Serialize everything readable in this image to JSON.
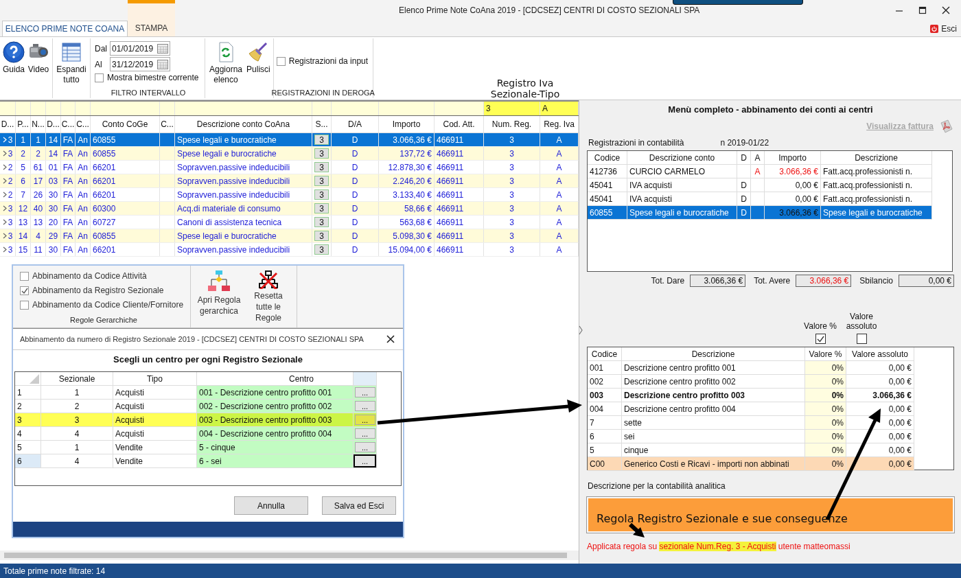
{
  "window": {
    "title": "Elenco Prime Note CoAna 2019 - [CDCSEZ] CENTRI DI COSTO SEZIONALI SPA",
    "exit_label": "Esci"
  },
  "ribbon": {
    "tabs": [
      {
        "label": "ELENCO PRIME NOTE COANA",
        "selected": true
      },
      {
        "label": "STAMPA",
        "selected": false
      }
    ],
    "guide": "Guida",
    "video": "Video",
    "expand": "Espandi tutto",
    "date_filter": {
      "from_label": "Dal",
      "from": "01/01/2019",
      "to_label": "Al",
      "to": "31/12/2019",
      "bimester": {
        "label": "Mostra bimestre corrente",
        "checked": false
      },
      "group_label": "FILTRO INTERVALLO"
    },
    "refresh": "Aggiorna elenco",
    "clear": "Pulisci",
    "exceptions": {
      "input": {
        "label": "Registrazioni da input",
        "checked": false
      },
      "group_label": "REGISTRAZIONI IN DEROGA"
    }
  },
  "grid": {
    "filter_caption": "Registro Iva Sezionale-Tipo",
    "filters": {
      "num_reg": "3",
      "reg_iva": "A"
    },
    "columns": [
      "D...",
      "P...",
      "N...",
      "D...",
      "C...",
      "C...",
      "Conto CoGe",
      "C...",
      "Descrizione conto CoAna",
      "S...",
      "D/A",
      "Importo",
      "Cod. Att.",
      "Num. Reg.",
      "Reg. Iva"
    ],
    "rows": [
      {
        "d": "3",
        "p": "1",
        "n": "1",
        "d2": "14",
        "c": "FA",
        "c2": "An",
        "conto": "60855",
        "descrizione": "Spese legali e burocratiche",
        "s": "3",
        "da": "D",
        "importo": "3.066,36 €",
        "cod_att": "466911",
        "num_reg": "3",
        "reg_iva": "A",
        "selected": true
      },
      {
        "d": "3",
        "p": "2",
        "n": "2",
        "d2": "14",
        "c": "FA",
        "c2": "An",
        "conto": "60855",
        "descrizione": "Spese legali e burocratiche",
        "s": "3",
        "da": "D",
        "importo": "137,72 €",
        "cod_att": "466911",
        "num_reg": "3",
        "reg_iva": "A",
        "selected": false
      },
      {
        "d": "2",
        "p": "5",
        "n": "61",
        "d2": "01",
        "c": "FA",
        "c2": "An",
        "conto": "66201",
        "descrizione": "Sopravven.passive indeducibili",
        "s": "3",
        "da": "D",
        "importo": "12.878,30 €",
        "cod_att": "466911",
        "num_reg": "3",
        "reg_iva": "A",
        "selected": false
      },
      {
        "d": "2",
        "p": "6",
        "n": "17",
        "d2": "03",
        "c": "FA",
        "c2": "An",
        "conto": "66201",
        "descrizione": "Sopravven.passive indeducibili",
        "s": "3",
        "da": "D",
        "importo": "2.246,20 €",
        "cod_att": "466911",
        "num_reg": "3",
        "reg_iva": "A",
        "selected": false
      },
      {
        "d": "2",
        "p": "7",
        "n": "26",
        "d2": "30",
        "c": "FA",
        "c2": "An",
        "conto": "66201",
        "descrizione": "Sopravven.passive indeducibili",
        "s": "3",
        "da": "D",
        "importo": "3.133,40 €",
        "cod_att": "466911",
        "num_reg": "3",
        "reg_iva": "A",
        "selected": false
      },
      {
        "d": "3",
        "p": "12",
        "n": "40",
        "d2": "30",
        "c": "FA",
        "c2": "An",
        "conto": "60300",
        "descrizione": "Acq.di materiale di consumo",
        "s": "3",
        "da": "D",
        "importo": "58,66 €",
        "cod_att": "466911",
        "num_reg": "3",
        "reg_iva": "A",
        "selected": false
      },
      {
        "d": "3",
        "p": "13",
        "n": "13",
        "d2": "20",
        "c": "FA",
        "c2": "An",
        "conto": "60727",
        "descrizione": "Canoni di assistenza tecnica",
        "s": "3",
        "da": "D",
        "importo": "563,68 €",
        "cod_att": "466911",
        "num_reg": "3",
        "reg_iva": "A",
        "selected": false
      },
      {
        "d": "3",
        "p": "14",
        "n": "4",
        "d2": "29",
        "c": "FA",
        "c2": "An",
        "conto": "60855",
        "descrizione": "Spese legali e burocratiche",
        "s": "3",
        "da": "D",
        "importo": "5.098,30 €",
        "cod_att": "466911",
        "num_reg": "3",
        "reg_iva": "A",
        "selected": false
      },
      {
        "d": "3",
        "p": "15",
        "n": "11",
        "d2": "30",
        "c": "FA",
        "c2": "An",
        "conto": "66201",
        "descrizione": "Sopravven.passive indeducibili",
        "s": "3",
        "da": "D",
        "importo": "15.094,00 €",
        "cod_att": "466911",
        "num_reg": "3",
        "reg_iva": "A",
        "selected": false
      }
    ]
  },
  "accounts_panel": {
    "title": "Menù completo - abbinamento dei conti ai centri",
    "invoice_link": "Visualizza fattura",
    "section_label": "Registrazioni in contabilità",
    "doc_number": "n 2019-01/22",
    "columns": [
      "Codice",
      "Descrizione conto",
      "D",
      "A",
      "Importo",
      "Descrizione"
    ],
    "rows": [
      {
        "codice": "412736",
        "conto": "CURCIO CARMELO",
        "a": "A",
        "importo": "3.066,36 €",
        "descrizione": "Fatt.acq.professionisti n.",
        "kind": "avere",
        "selected": false
      },
      {
        "codice": "45041",
        "conto": "IVA acquisti",
        "d": "D",
        "importo": "0,00 €",
        "descrizione": "Fatt.acq.professionisti n.",
        "kind": "dare",
        "selected": false
      },
      {
        "codice": "45041",
        "conto": "IVA acquisti",
        "d": "D",
        "importo": "0,00 €",
        "descrizione": "Fatt.acq.professionisti n.",
        "kind": "dare",
        "selected": false
      },
      {
        "codice": "60855",
        "conto": "Spese legali e burocratiche",
        "d": "D",
        "importo": "3.066,36 €",
        "descrizione": "Spese legali e burocratiche",
        "kind": "dare",
        "selected": true
      }
    ],
    "totals": [
      {
        "label": "Tot. Dare",
        "value": "3.066,36 €",
        "kind": "dare"
      },
      {
        "label": "Tot. Avere",
        "value": "3.066,36 €",
        "kind": "avere"
      },
      {
        "label": "Sbilancio",
        "value": "0,00 €",
        "kind": "balance"
      }
    ]
  },
  "centers_panel": {
    "value_modes": [
      {
        "label": "Valore %",
        "checked": true
      },
      {
        "label": "Valore assoluto",
        "checked": false
      }
    ],
    "columns": [
      "Codice",
      "Descrizione",
      "Valore %",
      "Valore assoluto"
    ],
    "rows": [
      {
        "codice": "001",
        "descrizione": "Descrizione centro profitto 001",
        "percent": "0%",
        "value": "0,00 €",
        "kind": "center",
        "highlighted": false
      },
      {
        "codice": "002",
        "descrizione": "Descrizione centro profitto 002",
        "percent": "0%",
        "value": "0,00 €",
        "kind": "center",
        "highlighted": false
      },
      {
        "codice": "003",
        "descrizione": "Descrizione centro profitto 003",
        "percent": "0%",
        "value": "3.066,36 €",
        "kind": "center",
        "highlighted": true
      },
      {
        "codice": "004",
        "descrizione": "Descrizione centro profitto 004",
        "percent": "0%",
        "value": "0,00 €",
        "kind": "center",
        "highlighted": false
      },
      {
        "codice": "7",
        "descrizione": "sette",
        "percent": "0%",
        "value": "0,00 €",
        "kind": "center",
        "highlighted": false
      },
      {
        "codice": "6",
        "descrizione": "sei",
        "percent": "0%",
        "value": "0,00 €",
        "kind": "center",
        "highlighted": false
      },
      {
        "codice": "5",
        "descrizione": "cinque",
        "percent": "0%",
        "value": "0,00 €",
        "kind": "center",
        "highlighted": false
      },
      {
        "codice": "C00",
        "descrizione": "Generico Costi e Ricavi - importi non abbinati",
        "percent": "0%",
        "value": "0,00 €",
        "kind": "generic",
        "highlighted": false
      }
    ],
    "analytic_label": "Descrizione per la contabilità analitica",
    "analytic_description": "Regola Registro Sezionale e sue conseguenze",
    "rule_note": {
      "text": "Applicata regola su",
      "highlight": "sezionale Num.Reg. 3 - Acquisti",
      "user": "utente matteomassi"
    }
  },
  "rules_panel": {
    "options": [
      {
        "label": "Abbinamento da Codice Attività",
        "checked": false
      },
      {
        "label": "Abbinamento da Registro Sezionale",
        "checked": true
      },
      {
        "label": "Abbinamento da Codice Cliente/Fornitore",
        "checked": false
      }
    ],
    "group_label": "Regole Gerarchiche",
    "open_rule": "Apri Regola gerarchica",
    "reset_rules": "Resetta tutte le Regole"
  },
  "dialog": {
    "title": "Abbinamento da numero di Registro Sezionale 2019 - [CDCSEZ] CENTRI DI COSTO SEZIONALI SPA",
    "heading": "Scegli un centro per ogni Registro Sezionale",
    "columns": [
      "Sezionale",
      "Tipo",
      "Centro"
    ],
    "rows": [
      {
        "index": "1",
        "sezionale": "1",
        "tipo": "Acquisti",
        "centro": "001 - Descrizione centro profitto 001",
        "pick": "...",
        "highlighted": false,
        "selected": false
      },
      {
        "index": "2",
        "sezionale": "2",
        "tipo": "Acquisti",
        "centro": "002 - Descrizione centro profitto 002",
        "pick": "...",
        "highlighted": false,
        "selected": false
      },
      {
        "index": "3",
        "sezionale": "3",
        "tipo": "Acquisti",
        "centro": "003 - Descrizione centro profitto 003",
        "pick": "...",
        "highlighted": true,
        "selected": false
      },
      {
        "index": "4",
        "sezionale": "4",
        "tipo": "Acquisti",
        "centro": "004 - Descrizione centro profitto 004",
        "pick": "...",
        "highlighted": false,
        "selected": false
      },
      {
        "index": "5",
        "sezionale": "1",
        "tipo": "Vendite",
        "centro": "5 - cinque",
        "pick": "...",
        "highlighted": false,
        "selected": false
      },
      {
        "index": "6",
        "sezionale": "4",
        "tipo": "Vendite",
        "centro": "6 - sei",
        "pick": "...",
        "highlighted": false,
        "selected": true
      }
    ],
    "buttons": [
      "Annulla",
      "Salva ed Esci"
    ]
  },
  "status_bar": "Totale prime note filtrate: 14"
}
